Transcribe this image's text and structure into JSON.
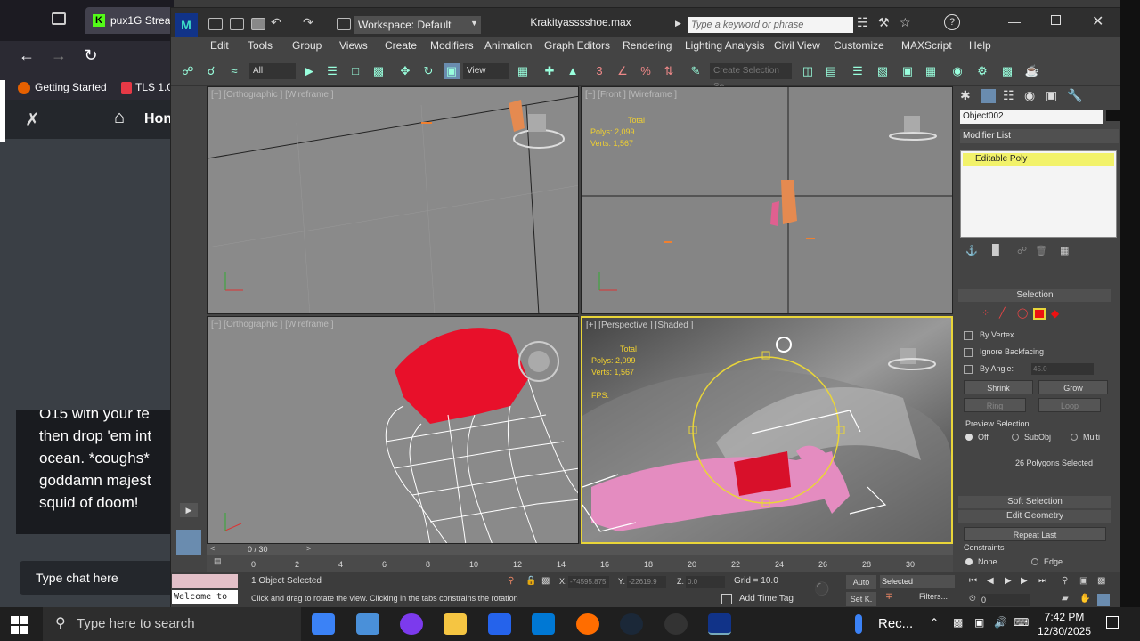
{
  "browser": {
    "tab_title": "pux1G Strea",
    "bookmarks": [
      "Getting Started",
      "TLS 1.0"
    ],
    "site_home": "Hon",
    "chat_lines": [
      "O15 with your te",
      "then drop 'em int",
      "ocean. *coughs*",
      "goddamn majest",
      "squid of doom!"
    ],
    "chat_placeholder": "Type chat here"
  },
  "max": {
    "workspace": "Workspace: Default",
    "title": "Krakityasssshoe.max",
    "search_placeholder": "Type a keyword or phrase",
    "menus": [
      "Edit",
      "Tools",
      "Group",
      "Views",
      "Create",
      "Modifiers",
      "Animation",
      "Graph Editors",
      "Rendering",
      "Lighting Analysis",
      "Civil View",
      "Customize",
      "MAXScript",
      "Help"
    ],
    "toolbar": {
      "selection_filter": "All",
      "ref_coord": "View",
      "named_selection": "Create Selection Se"
    },
    "viewports": [
      {
        "label": "[+] [Orthographic ] [Wireframe ]"
      },
      {
        "label": "[+] [Front ] [Wireframe ]",
        "stats": {
          "total": "Total",
          "polys": "Polys:   2,099",
          "verts": "Verts:   1,567"
        }
      },
      {
        "label": "[+] [Orthographic ] [Wireframe ]"
      },
      {
        "label": "[+] [Perspective ] [Shaded ]",
        "stats": {
          "total": "Total",
          "polys": "Polys:   2,099",
          "verts": "Verts:   1,567",
          "fps": "FPS:"
        }
      }
    ],
    "command_panel": {
      "object_name": "Object002",
      "modifier_list": "Modifier List",
      "stack_item": "Editable Poly",
      "selection_header": "Selection",
      "by_vertex": "By Vertex",
      "ignore_backfacing": "Ignore Backfacing",
      "by_angle": "By Angle:",
      "angle_value": "45.0",
      "shrink": "Shrink",
      "grow": "Grow",
      "ring": "Ring",
      "loop": "Loop",
      "preview_selection": "Preview Selection",
      "preview_opts": [
        "Off",
        "SubObj",
        "Multi"
      ],
      "selected_count": "26 Polygons Selected",
      "soft_selection": "Soft Selection",
      "edit_geometry": "Edit Geometry",
      "repeat_last": "Repeat Last",
      "constraints": "Constraints",
      "constraint_opts": [
        "None",
        "Edge"
      ]
    },
    "timeline": {
      "slider": "0 / 30",
      "ticks": [
        "0",
        "2",
        "4",
        "6",
        "8",
        "10",
        "12",
        "14",
        "16",
        "18",
        "20",
        "22",
        "24",
        "26",
        "28",
        "30"
      ]
    },
    "status": {
      "welcome": "Welcome to",
      "objects_selected": "1 Object Selected",
      "prompt": "Click and drag to rotate the view.  Clicking in the tabs constrains the rotation",
      "x": "-74595.875",
      "y": "-22619.9",
      "z": "0.0",
      "x_label": "X:",
      "y_label": "Y:",
      "z_label": "Z:",
      "grid": "Grid = 10.0",
      "add_time_tag": "Add Time Tag",
      "auto": "Auto",
      "set_key": "Set K.",
      "selected_dropdown": "Selected",
      "filters": "Filters...",
      "frame": "0"
    }
  },
  "taskbar": {
    "search": "Type here to search",
    "rec": "Rec...",
    "time": "7:42 PM",
    "date": "12/30/2025"
  },
  "colors": {
    "accent_yellow": "#e9d539",
    "mesh_red": "#d8102a",
    "mesh_pink": "#e47ab0"
  }
}
